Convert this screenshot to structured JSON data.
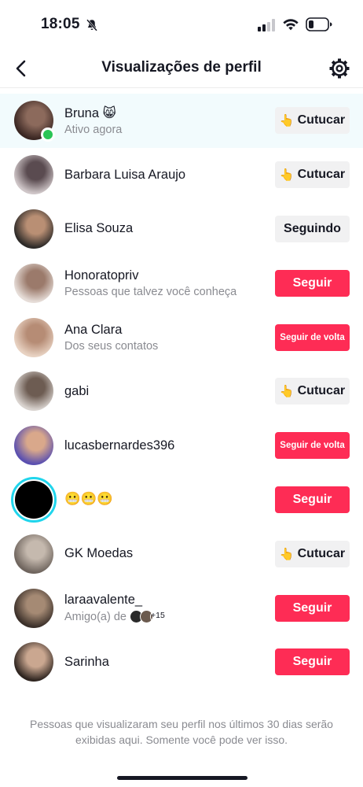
{
  "status_bar": {
    "time": "18:05"
  },
  "header": {
    "title": "Visualizações de perfil"
  },
  "rows": [
    {
      "name": "Bruna 😸",
      "subtitle": "Ativo agora",
      "button": "Cutucar",
      "button_style": "gray",
      "hand": "👆",
      "online": true,
      "highlight": true,
      "avatar_colors": [
        "#3a2622",
        "#8c6a5c"
      ]
    },
    {
      "name": "Barbara Luisa Araujo",
      "subtitle": "",
      "button": "Cutucar",
      "button_style": "gray",
      "hand": "👆",
      "avatar_colors": [
        "#cfc6c8",
        "#5a4b50"
      ]
    },
    {
      "name": "Elisa Souza",
      "subtitle": "",
      "button": "Seguindo",
      "button_style": "gray",
      "avatar_colors": [
        "#2d2a28",
        "#b98f74"
      ]
    },
    {
      "name": "Honoratopriv",
      "subtitle": "Pessoas que talvez você conheça",
      "button": "Seguir",
      "button_style": "red",
      "avatar_colors": [
        "#e6ddd8",
        "#9b7a6b"
      ]
    },
    {
      "name": "Ana Clara",
      "subtitle": "Dos seus contatos",
      "button": "Seguir de volta",
      "button_style": "red-small",
      "avatar_colors": [
        "#e8d2c2",
        "#b68c75"
      ]
    },
    {
      "name": "gabi",
      "subtitle": "",
      "button": "Cutucar",
      "button_style": "gray",
      "hand": "👆",
      "avatar_colors": [
        "#d9d3cf",
        "#6d5c52"
      ]
    },
    {
      "name": "lucasbernardes396",
      "subtitle": "",
      "button": "Seguir de volta",
      "button_style": "red-small",
      "avatar_colors": [
        "#5a4fb0",
        "#d9a88b"
      ]
    },
    {
      "name": "😬😬😬",
      "subtitle": "",
      "button": "Seguir",
      "button_style": "red",
      "story": true,
      "avatar_colors": [
        "#000000",
        "#000000"
      ]
    },
    {
      "name": "GK Moedas",
      "subtitle": "",
      "button": "Cutucar",
      "button_style": "gray",
      "hand": "👆",
      "avatar_colors": [
        "#6f655e",
        "#c5b9ae"
      ]
    },
    {
      "name": "laraavalente_",
      "subtitle": "Amigo(a) de",
      "mutual_count": "+15",
      "button": "Seguir",
      "button_style": "red",
      "avatar_colors": [
        "#3b302a",
        "#a58a74"
      ]
    },
    {
      "name": "Sarinha",
      "subtitle": "",
      "button": "Seguir",
      "button_style": "red",
      "avatar_colors": [
        "#2f2520",
        "#caa790"
      ]
    }
  ],
  "footer_note": "Pessoas que visualizaram seu perfil nos últimos 30 dias serão exibidas aqui. Somente você pode ver isso.",
  "colors": {
    "primary_red": "#fe2c55",
    "gray_button": "#f1f1f2",
    "online_green": "#2bc556",
    "story_ring": "#20d5ec"
  }
}
